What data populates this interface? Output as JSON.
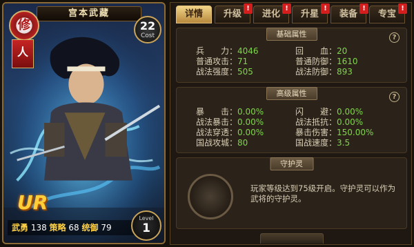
{
  "card": {
    "name": "宫本武藏",
    "cost_value": "22",
    "cost_label": "Cost",
    "emblem_char": "修",
    "banner_char": "人",
    "rarity": "UR",
    "stats": {
      "wuyong_label": "武勇",
      "wuyong_value": "138",
      "celue_label": "策略",
      "celue_value": "68",
      "tongyu_label": "统御",
      "tongyu_value": "79"
    },
    "level_label": "Level",
    "level_value": "1"
  },
  "tabs": [
    {
      "label": "详情",
      "active": true,
      "alert": false
    },
    {
      "label": "升级",
      "active": false,
      "alert": true
    },
    {
      "label": "进化",
      "active": false,
      "alert": true
    },
    {
      "label": "升星",
      "active": false,
      "alert": true
    },
    {
      "label": "装备",
      "active": false,
      "alert": true
    },
    {
      "label": "专宝",
      "active": false,
      "alert": true
    }
  ],
  "alert_mark": "!",
  "basic": {
    "title": "基础属性",
    "help": "?",
    "rows": [
      {
        "k": "兵　　力：",
        "v": "4046",
        "k2": "回　　血：",
        "v2": "20"
      },
      {
        "k": "普通攻击：",
        "v": "71",
        "k2": "普通防御：",
        "v2": "1610"
      },
      {
        "k": "战法强度：",
        "v": "505",
        "k2": "战法防御：",
        "v2": "893"
      }
    ]
  },
  "advanced": {
    "title": "高级属性",
    "help": "?",
    "rows": [
      {
        "k": "暴　　击：",
        "v": "0.00%",
        "k2": "闪　　避：",
        "v2": "0.00%"
      },
      {
        "k": "战法暴击：",
        "v": "0.00%",
        "k2": "战法抵抗：",
        "v2": "0.00%"
      },
      {
        "k": "战法穿透：",
        "v": "0.00%",
        "k2": "暴击伤害：",
        "v2": "150.00%"
      },
      {
        "k": "国战攻城：",
        "v": "80",
        "k2": "国战速度：",
        "v2": "3.5"
      }
    ]
  },
  "guardian": {
    "title": "守护灵",
    "text": "玩家等级达到75级开启。守护灵可以作为武将的守护灵。"
  },
  "colors": {
    "value_green": "#7fd64a",
    "tab_active": "#e2c27a",
    "alert_red": "#d41e1e",
    "rarity_gold": "#ffcf3a"
  }
}
